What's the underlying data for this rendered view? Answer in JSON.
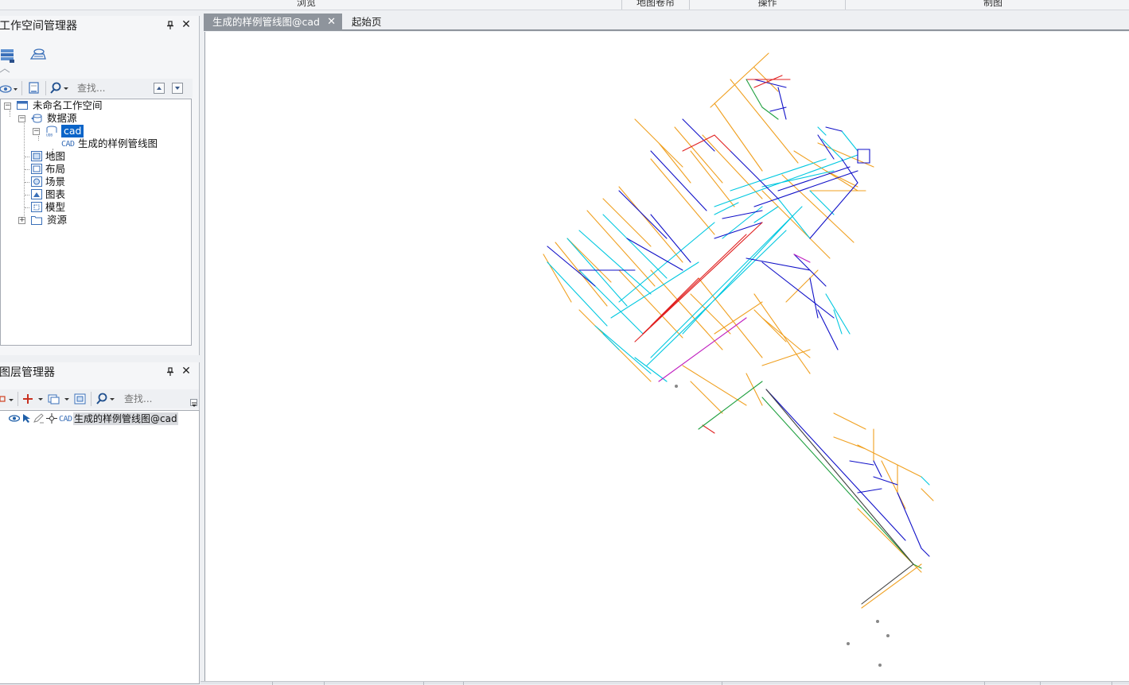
{
  "ribbon": {
    "groups": [
      "浏览",
      "地图卷帘",
      "操作",
      "制图"
    ]
  },
  "workspace_panel": {
    "title": "工作空间管理器",
    "search_placeholder": "查找...",
    "tree": {
      "root": "未命名工作空间",
      "datasource_folder": "数据源",
      "datasource": "cad",
      "dataset_prefix": "CAD",
      "dataset": "生成的样例管线图",
      "maps": "地图",
      "layouts": "布局",
      "scenes": "场景",
      "charts": "图表",
      "models": "模型",
      "resources": "资源"
    }
  },
  "layer_panel": {
    "title": "图层管理器",
    "search_placeholder": "查找...",
    "layer_type": "CAD",
    "layer_name": "生成的样例管线图@cad"
  },
  "tabs": {
    "active": "生成的样例管线图@cad",
    "close_symbol": "✕",
    "other": "起始页"
  },
  "panel_buttons": {
    "pin": "ᵖ",
    "close": "✕"
  },
  "colors": {
    "accent": "#0a64c8",
    "tab_active": "#8e949c",
    "pipe_orange": "#f0a020",
    "pipe_cyan": "#00c8e0",
    "pipe_blue": "#1010c8",
    "pipe_red": "#e02020",
    "pipe_green": "#20a040"
  }
}
